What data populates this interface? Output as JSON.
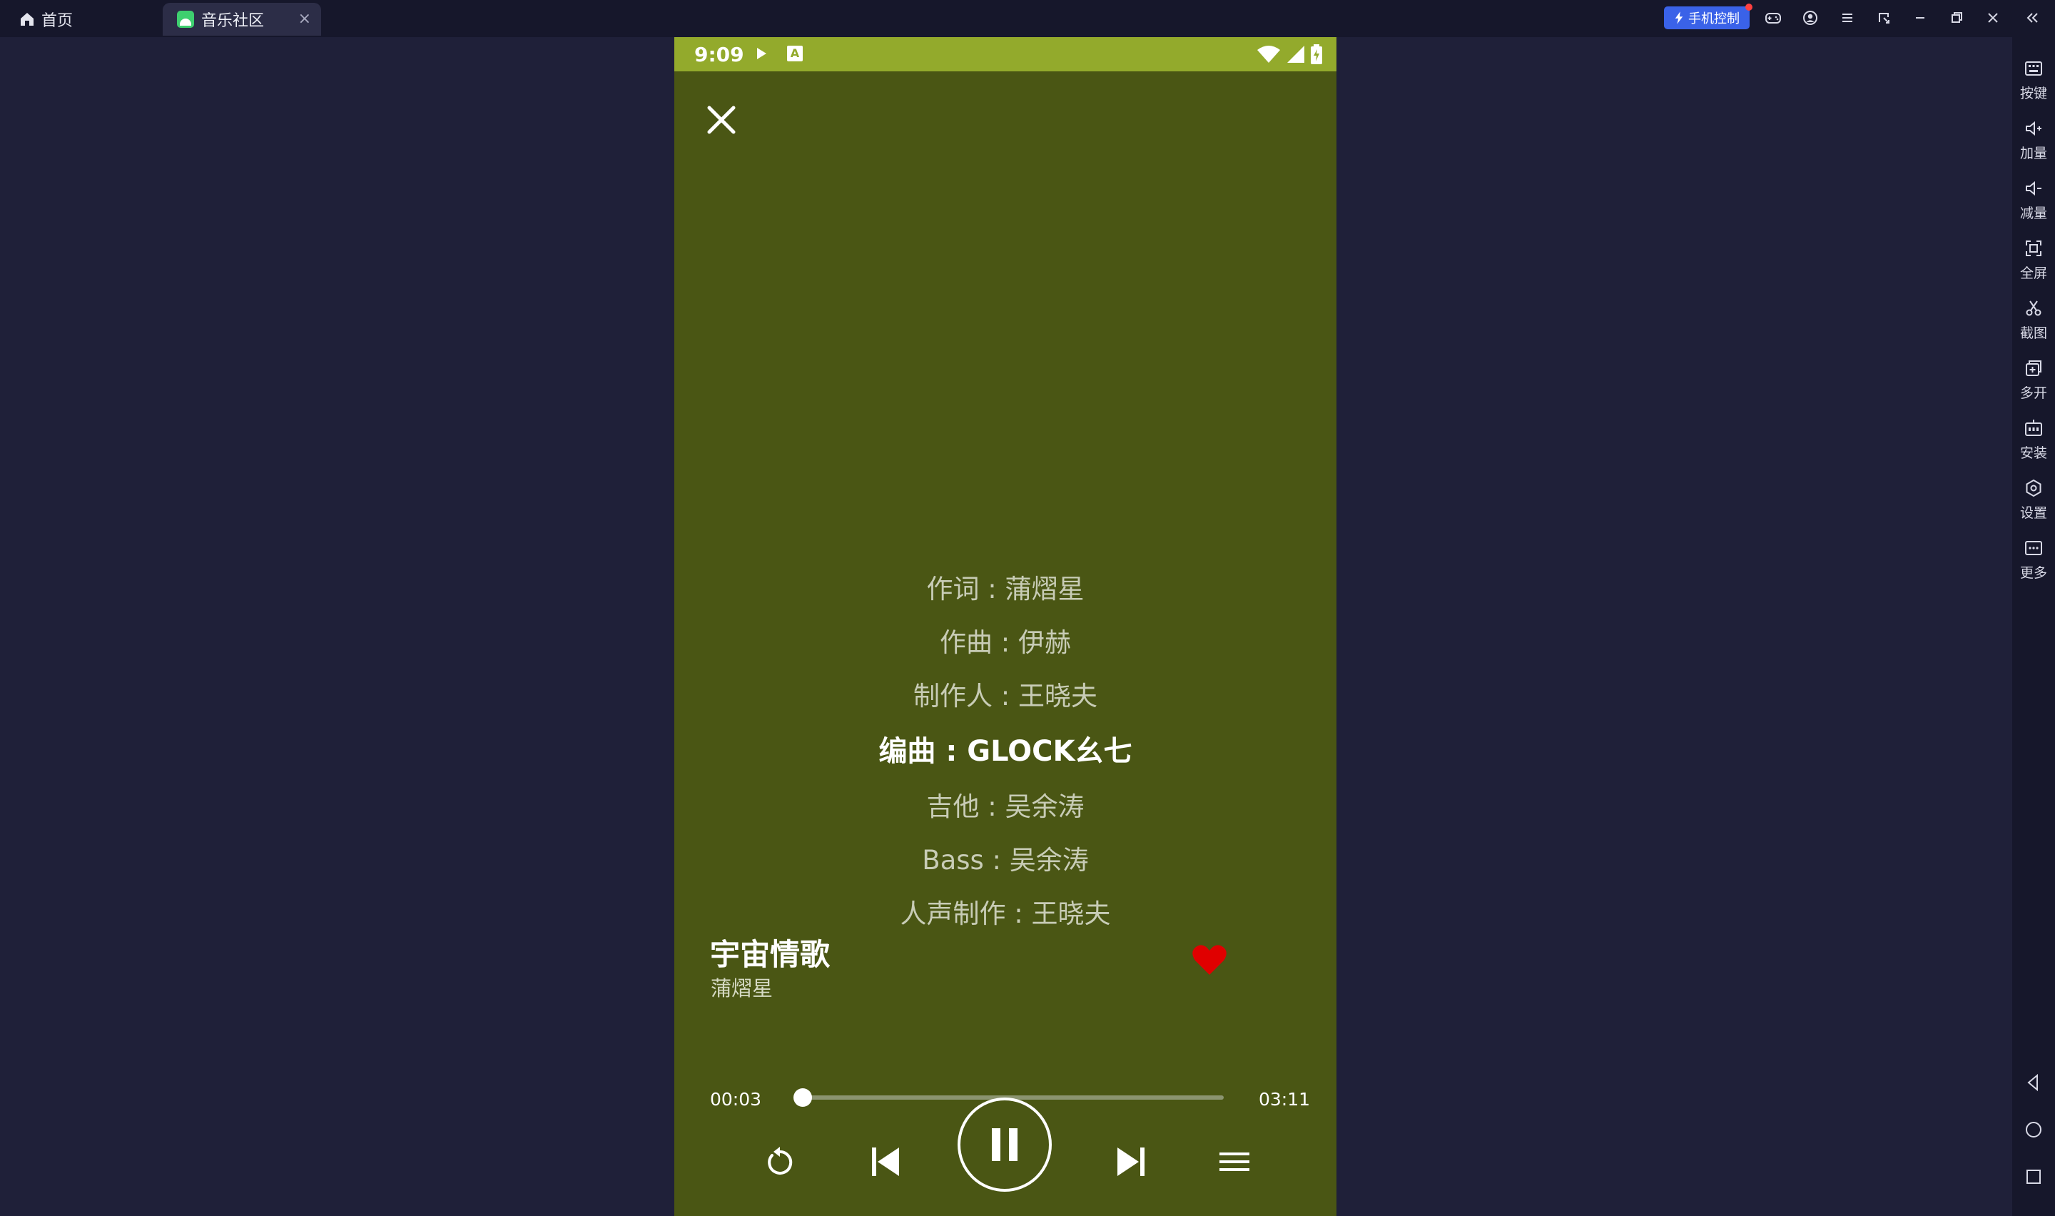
{
  "titlebar": {
    "home_tab_label": "首页",
    "app_tab_label": "音乐社区",
    "app_tab_close": "×",
    "phone_control_label": "手机控制"
  },
  "sidebar": {
    "items": [
      {
        "label": "按键",
        "icon": "keyboard-icon"
      },
      {
        "label": "加量",
        "icon": "volume-up-icon"
      },
      {
        "label": "减量",
        "icon": "volume-down-icon"
      },
      {
        "label": "全屏",
        "icon": "fullscreen-icon"
      },
      {
        "label": "截图",
        "icon": "scissors-icon"
      },
      {
        "label": "多开",
        "icon": "multi-instance-icon"
      },
      {
        "label": "安装",
        "icon": "apk-install-icon"
      },
      {
        "label": "设置",
        "icon": "settings-icon"
      },
      {
        "label": "更多",
        "icon": "more-icon"
      }
    ]
  },
  "statusbar": {
    "time": "9:09",
    "a_badge": "A"
  },
  "lyrics": [
    "作词 : 蒲熠星",
    "作曲 : 伊赫",
    "制作人 : 王晓夫",
    "编曲 : GLOCK幺七",
    "吉他 : 吴余涛",
    "Bass : 吴余涛",
    "人声制作 : 王晓夫"
  ],
  "active_lyric_index": 3,
  "song": {
    "title": "宇宙情歌",
    "artist": "蒲熠星",
    "favorited": true
  },
  "player": {
    "current_time": "00:03",
    "total_time": "03:11",
    "progress_fraction": 0.016
  },
  "colors": {
    "desktop_bg": "#1f2039",
    "player_bg": "#4a5614",
    "status_bar": "#93aa2c",
    "heart": "#e00000",
    "accent_button": "#3a62e8"
  }
}
